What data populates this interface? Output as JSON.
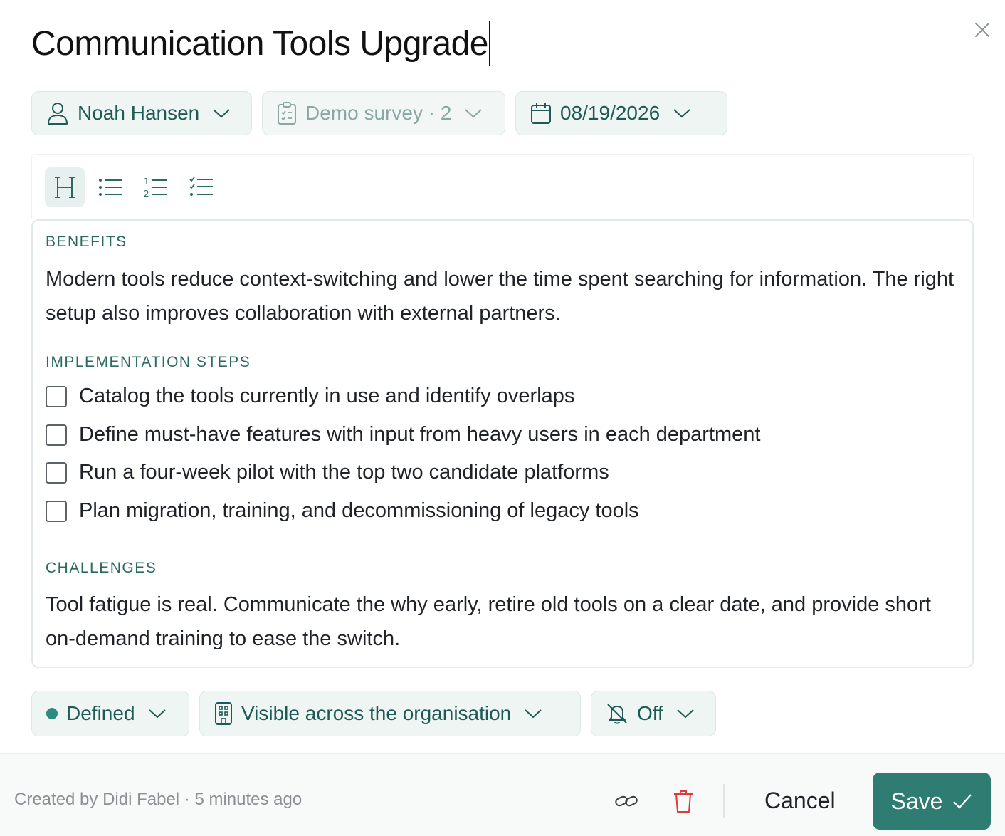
{
  "header": {
    "title": "Communication Tools Upgrade"
  },
  "meta": {
    "assignee": "Noah Hansen",
    "survey": "Demo survey · 2",
    "due_date": "08/19/2026"
  },
  "toolbar": {
    "buttons": [
      "heading",
      "bullet-list",
      "numbered-list",
      "checklist"
    ],
    "active": "heading"
  },
  "content": {
    "benefits_heading": "BENEFITS",
    "benefits_text": "Modern tools reduce context-switching and lower the time spent searching for information. The right setup also improves collaboration with external partners.",
    "steps_heading": "IMPLEMENTATION STEPS",
    "steps": [
      {
        "text": "Catalog the tools currently in use and identify overlaps",
        "checked": false
      },
      {
        "text": "Define must-have features with input from heavy users in each department",
        "checked": false
      },
      {
        "text": "Run a four-week pilot with the top two candidate platforms",
        "checked": false
      },
      {
        "text": "Plan migration, training, and decommissioning of legacy tools",
        "checked": false
      }
    ],
    "challenges_heading": "CHALLENGES",
    "challenges_text": "Tool fatigue is real. Communicate the why early, retire old tools on a clear date, and provide short on-demand training to ease the switch."
  },
  "settings": {
    "status": "Defined",
    "visibility": "Visible across the organisation",
    "notifications": "Off"
  },
  "footer": {
    "created": "Created by Didi Fabel · 5 minutes ago",
    "cancel_label": "Cancel",
    "save_label": "Save"
  },
  "colors": {
    "accent": "#2f7c73",
    "pill_bg": "#eef5f3",
    "heading_text": "#2a6a63",
    "delete": "#e0393e"
  }
}
